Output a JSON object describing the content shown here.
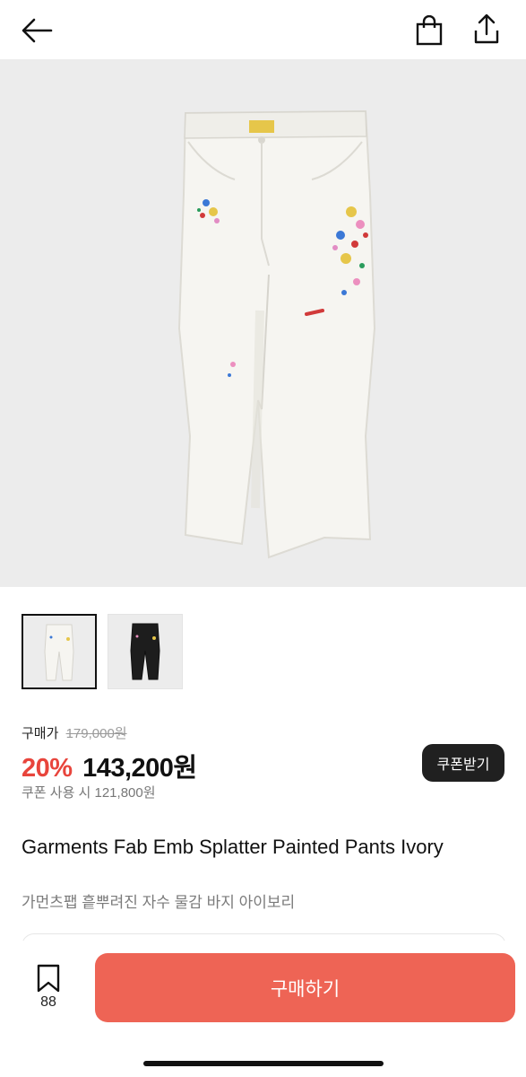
{
  "header": {
    "back_icon": "arrow-left-icon",
    "bag_icon": "shopping-bag-icon",
    "share_icon": "share-upload-icon"
  },
  "gallery": {
    "main_image": "ivory-pants-photo",
    "thumbnails": [
      {
        "name": "ivory-pants-thumbnail",
        "selected": true
      },
      {
        "name": "black-pants-thumbnail",
        "selected": false
      }
    ]
  },
  "price": {
    "label": "구매가",
    "original": "179,000원",
    "discount": "20%",
    "final": "143,200원",
    "coupon_price": "쿠폰 사용 시 121,800원",
    "coupon_button": "쿠폰받기"
  },
  "product": {
    "title_en": "Garments Fab Emb Splatter Painted Pants Ivory",
    "title_ko": "가먼츠팹 흩뿌려진 자수 물감 바지 아이보리"
  },
  "bottom_bar": {
    "bookmark_count": "88",
    "buy_label": "구매하기"
  },
  "colors": {
    "accent_red": "#e8453c",
    "buy_button": "#ee6455",
    "coupon_button": "#202020"
  }
}
